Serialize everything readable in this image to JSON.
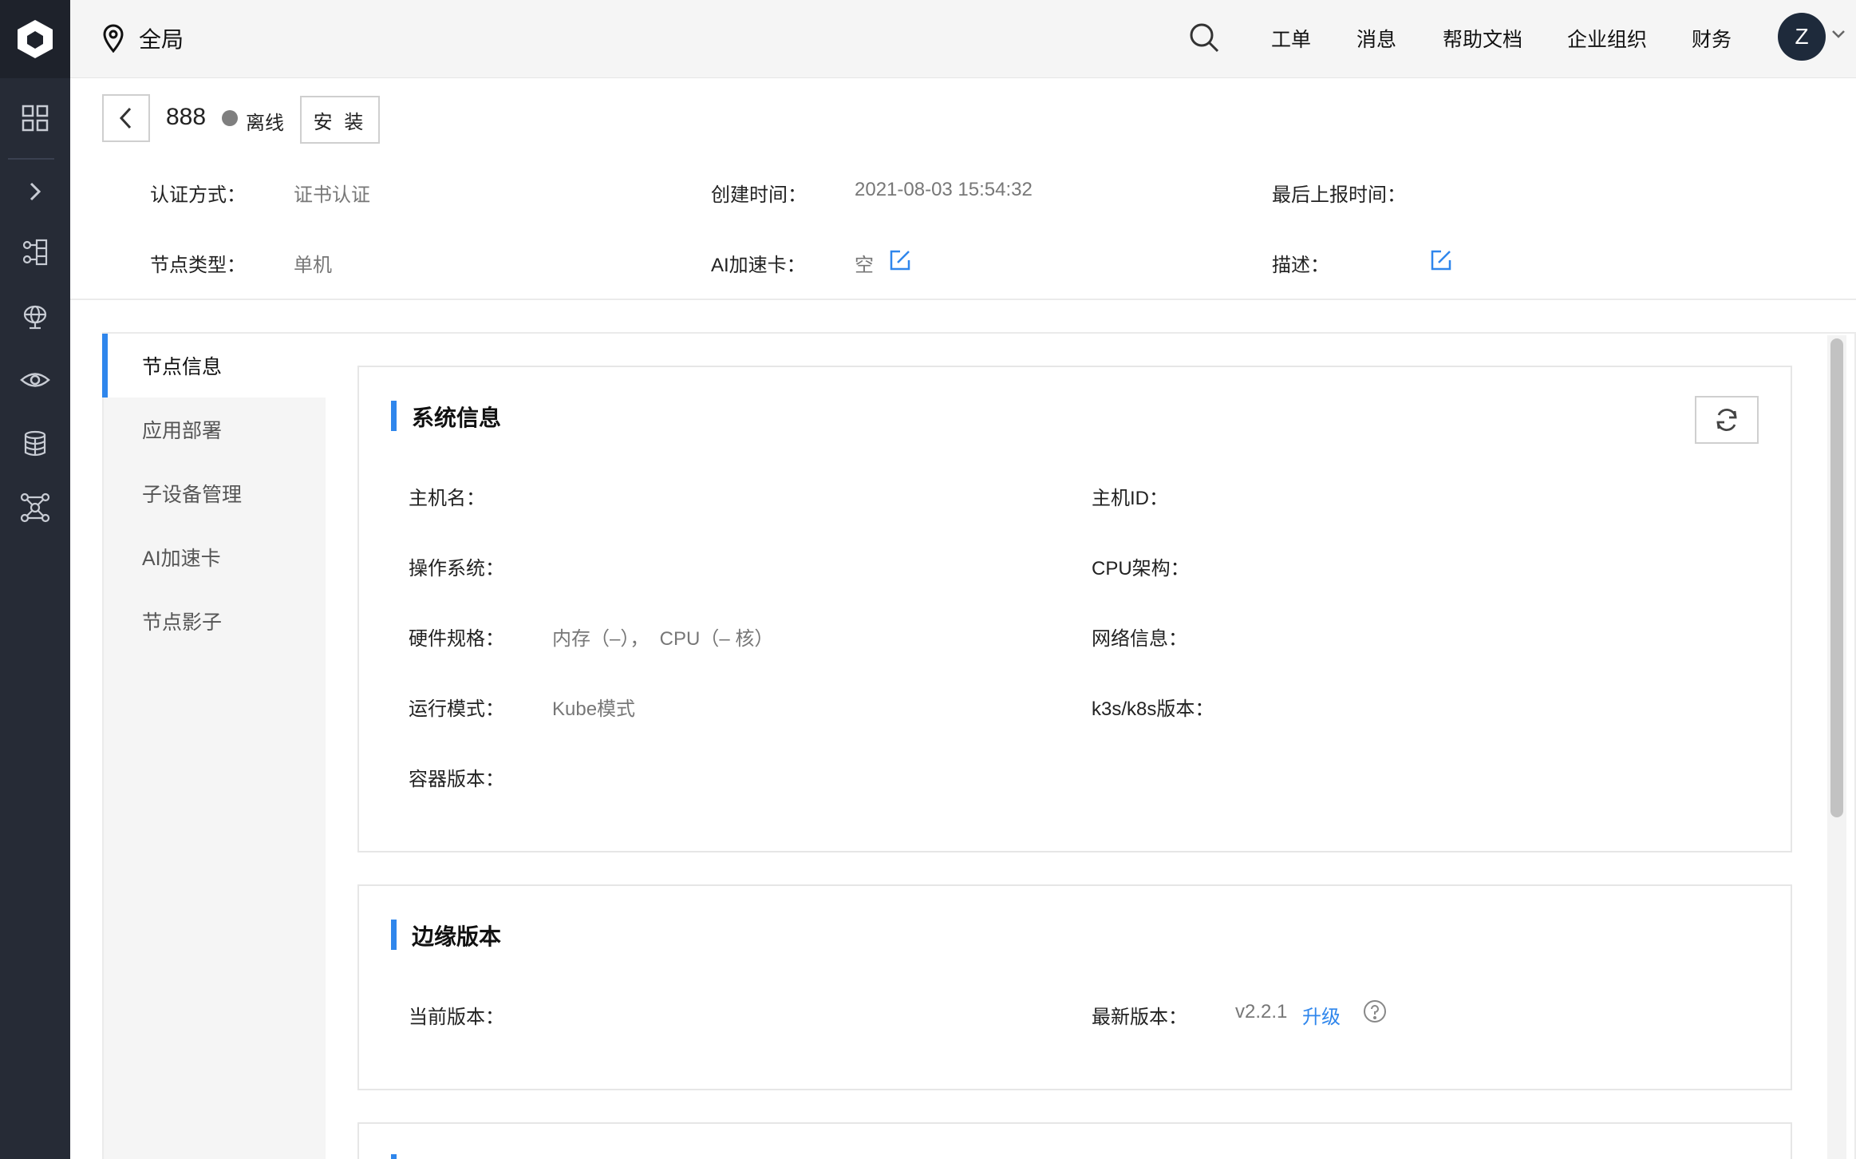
{
  "topbar": {
    "region": "全局",
    "links": [
      "工单",
      "消息",
      "帮助文档",
      "企业组织",
      "财务"
    ],
    "avatar_initial": "Z"
  },
  "node": {
    "name": "888",
    "status": "离线",
    "install_label": "安 装"
  },
  "meta": {
    "auth_label": "认证方式：",
    "auth_value": "证书认证",
    "created_label": "创建时间：",
    "created_value": "2021-08-03 15:54:32",
    "last_report_label": "最后上报时间：",
    "type_label": "节点类型：",
    "type_value": "单机",
    "ai_label": "AI加速卡：",
    "ai_value": "空",
    "desc_label": "描述："
  },
  "menu": {
    "items": [
      "节点信息",
      "应用部署",
      "子设备管理",
      "AI加速卡",
      "节点影子"
    ]
  },
  "system": {
    "title": "系统信息",
    "hostname_label": "主机名：",
    "hostid_label": "主机ID：",
    "os_label": "操作系统：",
    "cpu_arch_label": "CPU架构：",
    "hw_label": "硬件规格：",
    "hw_value": "内存（–），  CPU（– 核）",
    "net_label": "网络信息：",
    "mode_label": "运行模式：",
    "mode_value": "Kube模式",
    "k8s_label": "k3s/k8s版本：",
    "container_label": "容器版本："
  },
  "edge": {
    "title": "边缘版本",
    "current_label": "当前版本：",
    "latest_label": "最新版本：",
    "latest_value": "v2.2.1",
    "upgrade_label": "升级"
  },
  "colors": {
    "accent": "#2f86ec",
    "sidebar": "#262b36",
    "offline": "#7f7f7f"
  }
}
